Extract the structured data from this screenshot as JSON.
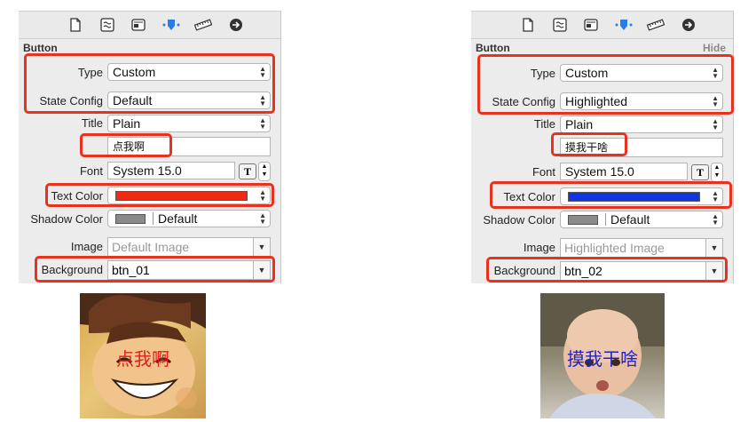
{
  "colors": {
    "highlight": "#e8321e",
    "text_color_left": "#ee2b12",
    "text_color_right": "#1336e0",
    "caption_left": "#e01e1e",
    "caption_right": "#2222cc"
  },
  "toolbar_icons": [
    "file-icon",
    "quick-help-icon",
    "identity-icon",
    "attributes-icon",
    "size-icon",
    "connections-icon"
  ],
  "left": {
    "section_title": "Button",
    "type_label": "Type",
    "type_value": "Custom",
    "state_label": "State Config",
    "state_value": "Default",
    "title_label": "Title",
    "title_value": "Plain",
    "title_text": "点我啊",
    "font_label": "Font",
    "font_value": "System 15.0",
    "font_button": "T",
    "text_color_label": "Text Color",
    "shadow_label": "Shadow Color",
    "shadow_value": "Default",
    "image_label": "Image",
    "image_placeholder": "Default Image",
    "background_label": "Background",
    "background_value": "btn_01",
    "caption": "点我啊"
  },
  "right": {
    "section_title": "Button",
    "hide_label": "Hide",
    "type_label": "Type",
    "type_value": "Custom",
    "state_label": "State Config",
    "state_value": "Highlighted",
    "title_label": "Title",
    "title_value": "Plain",
    "title_text": "摸我干啥",
    "font_label": "Font",
    "font_value": "System 15.0",
    "font_button": "T",
    "text_color_label": "Text Color",
    "shadow_label": "Shadow Color",
    "shadow_value": "Default",
    "image_label": "Image",
    "image_placeholder": "Highlighted Image",
    "background_label": "Background",
    "background_value": "btn_02",
    "caption": "摸我干啥"
  }
}
